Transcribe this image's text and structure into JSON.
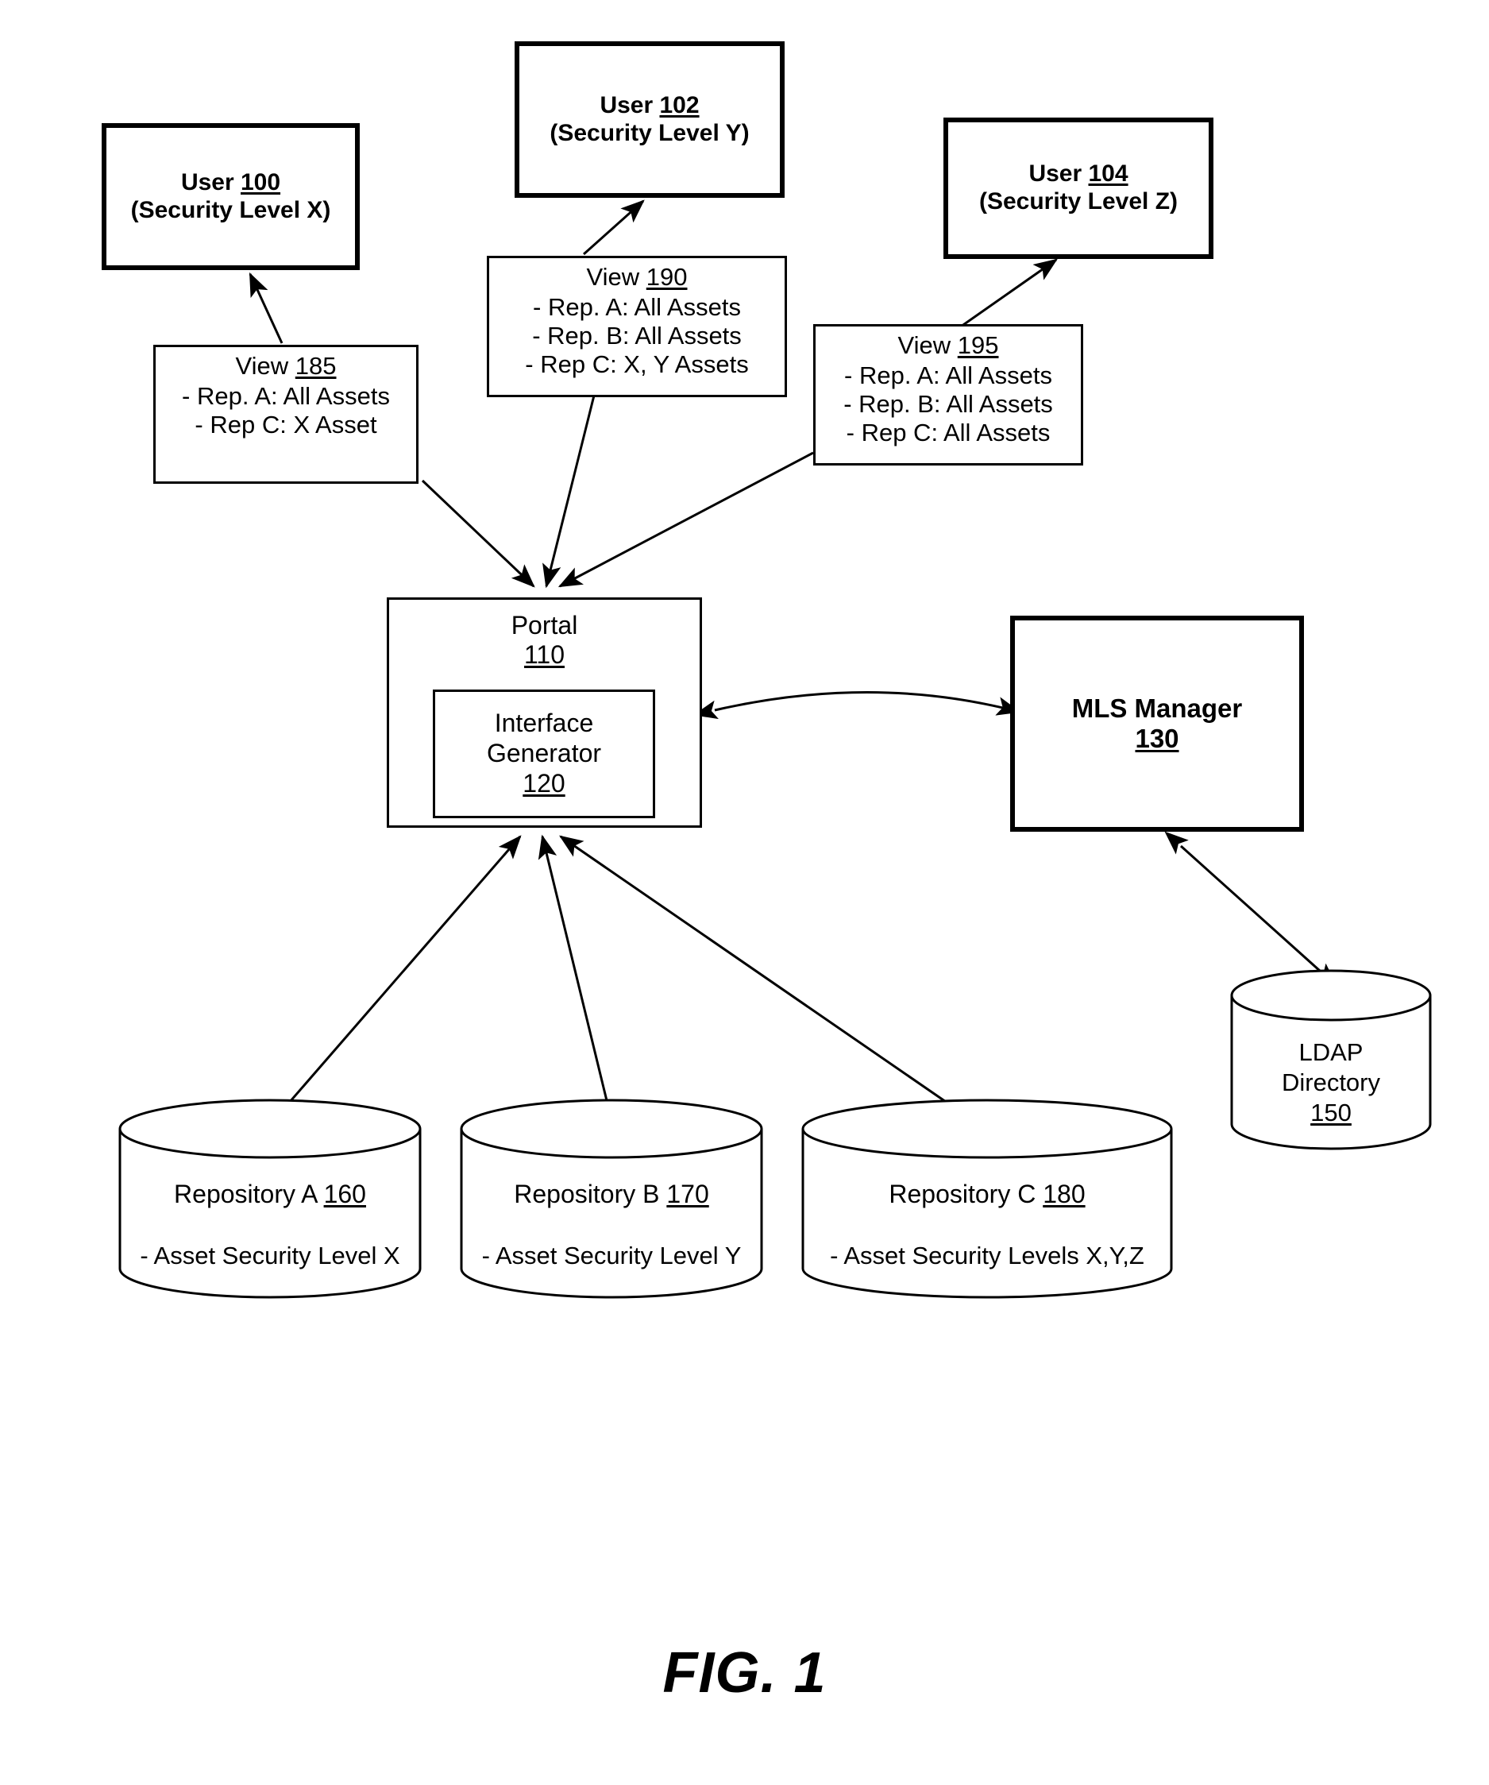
{
  "figure": {
    "caption": "FIG. 1"
  },
  "users": [
    {
      "name": "User",
      "ref": "100",
      "level": "(Security Level X)"
    },
    {
      "name": "User",
      "ref": "102",
      "level": "(Security Level Y)"
    },
    {
      "name": "User",
      "ref": "104",
      "level": "(Security Level Z)"
    }
  ],
  "views": [
    {
      "title": "View",
      "ref": "185",
      "lines": [
        "- Rep. A: All Assets",
        "- Rep C: X Asset"
      ]
    },
    {
      "title": "View",
      "ref": "190",
      "lines": [
        "- Rep. A: All Assets",
        "- Rep. B: All Assets",
        "- Rep C: X, Y Assets"
      ]
    },
    {
      "title": "View",
      "ref": "195",
      "lines": [
        "- Rep. A: All Assets",
        "- Rep. B: All Assets",
        "- Rep C: All Assets"
      ]
    }
  ],
  "portal": {
    "label": "Portal",
    "ref": "110",
    "interface_generator": {
      "line1": "Interface",
      "line2": "Generator",
      "ref": "120"
    }
  },
  "mls_manager": {
    "label": "MLS Manager",
    "ref": "130"
  },
  "ldap": {
    "line1": "LDAP",
    "line2": "Directory",
    "ref": "150"
  },
  "repositories": [
    {
      "label": "Repository A",
      "ref": "160",
      "detail": "- Asset Security Level X"
    },
    {
      "label": "Repository B",
      "ref": "170",
      "detail": "- Asset Security Level Y"
    },
    {
      "label": "Repository C",
      "ref": "180",
      "detail": "- Asset Security Levels X,Y,Z"
    }
  ],
  "colors": {
    "stroke": "#000000",
    "background": "#ffffff"
  }
}
